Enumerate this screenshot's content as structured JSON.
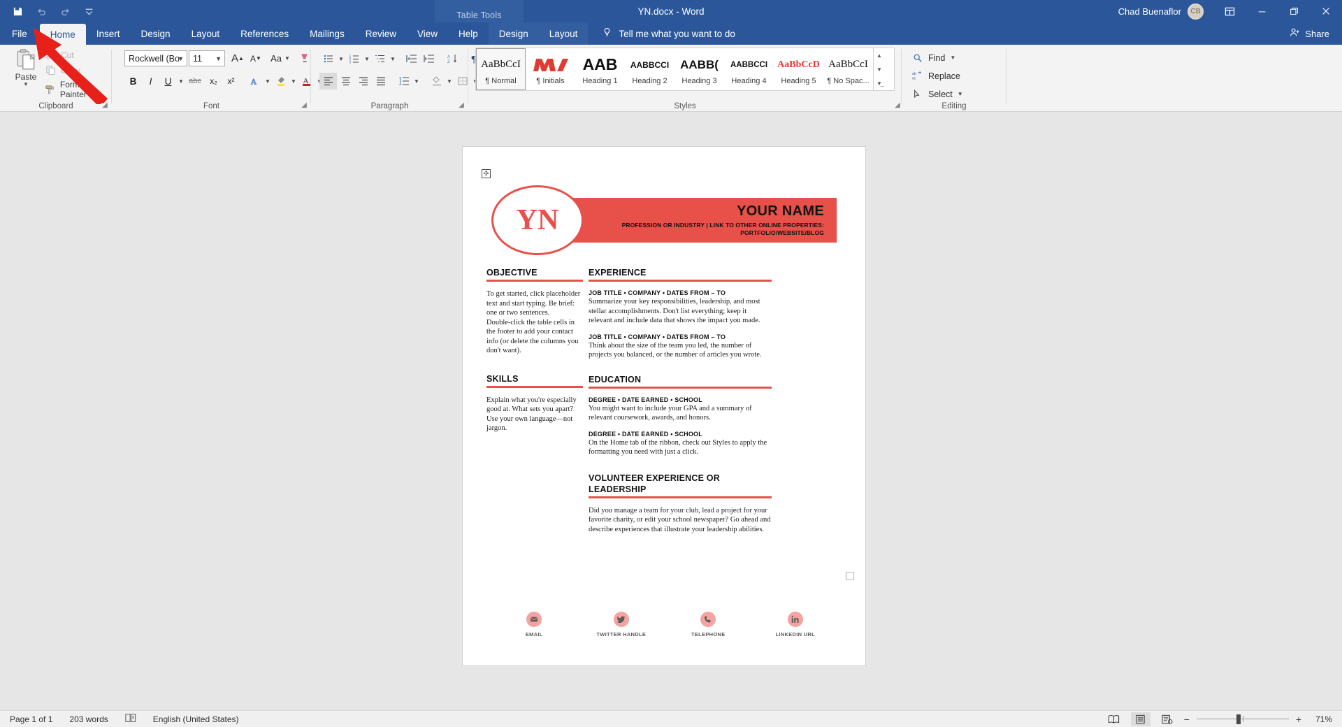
{
  "window": {
    "title": "YN.docx  -  Word",
    "contextual_tab_group": "Table Tools",
    "account_name": "Chad Buenaflor",
    "avatar_initials": "CB",
    "ribbon_display_icon": "ribbon-display-options-icon",
    "minimize_icon": "minimize-icon",
    "restore_icon": "restore-icon",
    "close_icon": "close-icon"
  },
  "quick_access": {
    "save_icon": "save-icon",
    "undo_icon": "undo-icon",
    "redo_icon": "redo-icon",
    "customize_icon": "customize-quick-access-toolbar-icon"
  },
  "tabs": [
    {
      "label": "File"
    },
    {
      "label": "Home"
    },
    {
      "label": "Insert"
    },
    {
      "label": "Design"
    },
    {
      "label": "Layout"
    },
    {
      "label": "References"
    },
    {
      "label": "Mailings"
    },
    {
      "label": "Review"
    },
    {
      "label": "View"
    },
    {
      "label": "Help"
    }
  ],
  "table_tools_tabs": [
    {
      "label": "Design"
    },
    {
      "label": "Layout"
    }
  ],
  "tell_me": {
    "label": "Tell me what you want to do",
    "icon": "lightbulb-icon"
  },
  "share": {
    "label": "Share",
    "icon": "share-person-icon"
  },
  "ribbon": {
    "clipboard": {
      "group_label": "Clipboard",
      "paste_label": "Paste",
      "items": [
        {
          "label": "Cut",
          "icon": "scissors-icon"
        },
        {
          "label": "Copy",
          "icon": "copy-icon"
        },
        {
          "label": "Format Painter",
          "icon": "format-painter-icon"
        }
      ]
    },
    "font": {
      "group_label": "Font",
      "font_name": "Rockwell (Bo",
      "font_size": "11",
      "grow_font": "A",
      "shrink_font": "A",
      "change_case": "Aa",
      "clear_formatting_icon": "clear-formatting-icon",
      "bold": "B",
      "italic": "I",
      "underline": "U",
      "strikethrough": "abc",
      "subscript": "x₂",
      "superscript": "x²",
      "text_effects_icon": "text-effects-icon",
      "highlight_icon": "text-highlight-color-icon",
      "font_color_icon": "font-color-icon"
    },
    "paragraph": {
      "group_label": "Paragraph",
      "bullets_icon": "bullets-icon",
      "numbering_icon": "numbering-icon",
      "multilevel_icon": "multilevel-list-icon",
      "decrease_indent_icon": "decrease-indent-icon",
      "increase_indent_icon": "increase-indent-icon",
      "sort_icon": "sort-icon",
      "show_marks_icon": "show-formatting-marks-icon",
      "align_left_icon": "align-left-icon",
      "align_center_icon": "align-center-icon",
      "align_right_icon": "align-right-icon",
      "justify_icon": "justify-icon",
      "line_spacing_icon": "line-spacing-icon",
      "shading_icon": "shading-icon",
      "borders_icon": "borders-icon"
    },
    "styles": {
      "group_label": "Styles",
      "items": [
        {
          "preview": "AaBbCcI",
          "name": "¶ Normal",
          "selected": true,
          "color": "#111111"
        },
        {
          "preview": "▲▼",
          "name": "¶ Initials",
          "selected": false,
          "color": "#e03a33"
        },
        {
          "preview": "AAB",
          "name": "Heading 1",
          "selected": false,
          "color": "#111111"
        },
        {
          "preview": "AABBCCI",
          "name": "Heading 2",
          "selected": false,
          "color": "#111111"
        },
        {
          "preview": "AABB(",
          "name": "Heading 3",
          "selected": false,
          "color": "#111111"
        },
        {
          "preview": "AABBCCI",
          "name": "Heading 4",
          "selected": false,
          "color": "#111111"
        },
        {
          "preview": "AaBbCcD",
          "name": "Heading 5",
          "selected": false,
          "color": "#e03a33"
        },
        {
          "preview": "AaBbCcI",
          "name": "¶ No Spac...",
          "selected": false,
          "color": "#111111"
        }
      ]
    },
    "editing": {
      "group_label": "Editing",
      "items": [
        {
          "label": "Find",
          "icon": "search-icon",
          "has_caret": true
        },
        {
          "label": "Replace",
          "icon": "replace-icon",
          "has_caret": false
        },
        {
          "label": "Select",
          "icon": "select-pointer-icon",
          "has_caret": true
        }
      ]
    }
  },
  "document": {
    "table_move_handle": "table-move-handle-icon",
    "header": {
      "logo_initials": "YN",
      "name": "YOUR NAME",
      "subtitle": "PROFESSION OR INDUSTRY | LINK TO OTHER ONLINE PROPERTIES: PORTFOLIO/WEBSITE/BLOG"
    },
    "left_column": [
      {
        "title": "OBJECTIVE",
        "paragraphs": [
          "To get started, click placeholder text and start typing. Be brief: one or two sentences.",
          "Double-click the table cells in the footer to add your contact info (or delete the columns you don't want)."
        ]
      },
      {
        "title": "SKILLS",
        "paragraphs": [
          "Explain what you're especially good at. What sets you apart? Use your own language—not jargon."
        ]
      }
    ],
    "right_column": [
      {
        "title": "EXPERIENCE",
        "entries": [
          {
            "heading": "JOB TITLE • COMPANY • DATES FROM – TO",
            "body": "Summarize your key responsibilities, leadership, and most stellar accomplishments.  Don't list everything; keep it relevant and include data that shows the impact you made."
          },
          {
            "heading": "JOB TITLE • COMPANY • DATES FROM – TO",
            "body": "Think about the size of the team you led, the number of projects you balanced, or the number of articles you wrote."
          }
        ]
      },
      {
        "title": "EDUCATION",
        "entries": [
          {
            "heading": "DEGREE • DATE EARNED • SCHOOL",
            "body": "You might want to include your GPA and a summary of relevant coursework, awards, and honors."
          },
          {
            "heading": "DEGREE • DATE EARNED • SCHOOL",
            "body": "On the Home tab of the ribbon, check out Styles to apply the formatting you need with just a click."
          }
        ]
      },
      {
        "title": "VOLUNTEER EXPERIENCE OR LEADERSHIP",
        "entries": [
          {
            "heading": "",
            "body": "Did you manage a team for your club, lead a project for your favorite charity, or edit your school newspaper? Go ahead and describe experiences that illustrate your leadership abilities."
          }
        ]
      }
    ],
    "contacts": [
      {
        "label": "EMAIL",
        "icon": "email-icon"
      },
      {
        "label": "TWITTER HANDLE",
        "icon": "twitter-icon"
      },
      {
        "label": "TELEPHONE",
        "icon": "phone-icon"
      },
      {
        "label": "LINKEDIN URL",
        "icon": "linkedin-icon"
      }
    ],
    "accent_color": "#e8504a"
  },
  "annotation": {
    "arrow_color": "#e8201a",
    "arrow_target": "file-tab"
  },
  "status_bar": {
    "page": "Page 1 of 1",
    "words": "203 words",
    "proofing_icon": "proofing-errors-icon",
    "language": "English (United States)",
    "read_mode_icon": "read-mode-icon",
    "print_layout_icon": "print-layout-icon",
    "web_layout_icon": "web-layout-icon",
    "zoom_out": "−",
    "zoom_in": "+",
    "zoom_percent": "71%"
  }
}
